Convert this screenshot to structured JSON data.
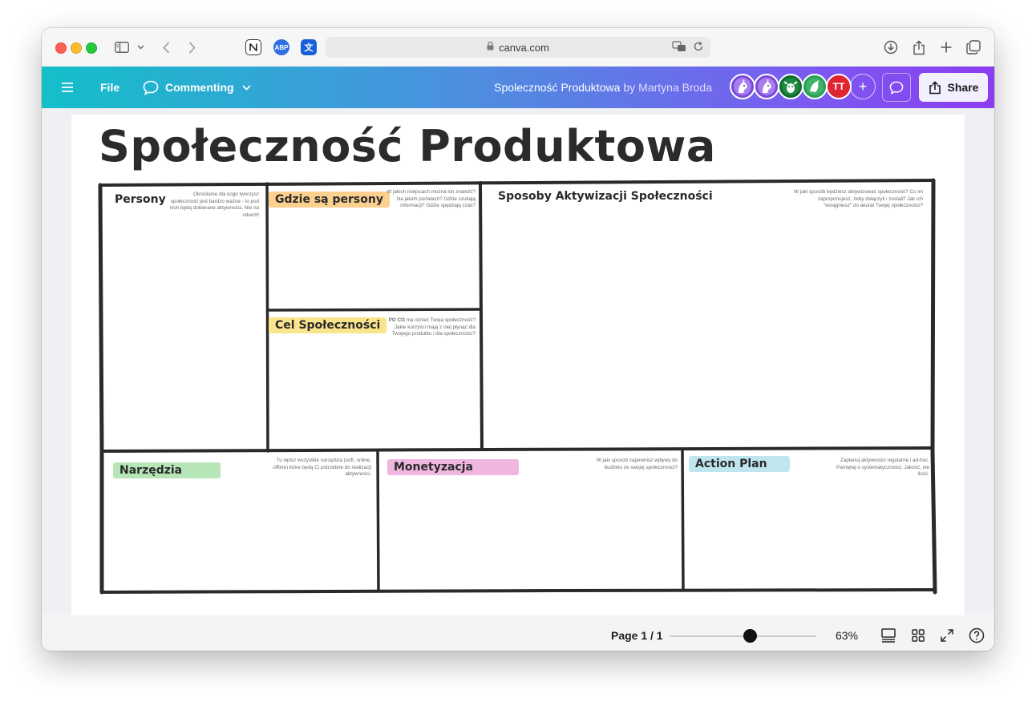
{
  "browser": {
    "url": "canva.com",
    "extensions": {
      "abp": "ABP",
      "translate": "文"
    }
  },
  "header": {
    "menu_icon": "hamburger-icon",
    "file_label": "File",
    "mode_label": "Commenting",
    "doc_title": "Spoleczność Produktowa",
    "by_label": "by",
    "author": "Martyna Broda",
    "avatar_initials": "TT",
    "add_label": "+",
    "share_label": "Share"
  },
  "canvas": {
    "title": "Społeczność Produktowa",
    "cells": {
      "persony": {
        "label": "Persony",
        "color": "#d7ecb4",
        "hint": "Określanie dla kogo tworzysz społeczność jest bardzo ważne - to pod nich będą dobierane aktywności. Nie na odwrót!"
      },
      "gdzie": {
        "label": "Gdzie są persony",
        "color": "#fbd08e",
        "hint": "W jakich miejscach można ich znaleźć? Na jakich portalach? Gdzie szukają informacji? Gdzie spędzają czas?"
      },
      "sposoby": {
        "label": "Sposoby Aktywizacji Społeczności",
        "color": "#fcae8a",
        "hint": "W jaki sposób będziesz aktywizować społeczność? Co im zaproponujesz, żeby dołączyli i zostali? Jak ich \"wciągniesz\" do akurat Twojej społeczności?"
      },
      "cel": {
        "label": "Cel Społeczności",
        "color": "#fbe58c",
        "hint_bold": "PO CO",
        "hint": "ma istnieć Twoja społeczność? Jakie korzyści mają z niej płynąć dla Twojego produktu i dla społeczności?"
      },
      "narzedzia": {
        "label": "Narzędzia",
        "color": "#b6e6b8",
        "hint": "Tu wpisz wszystkie narzędzia (soft, online, offline) które będą Ci potrzebne do realizacji aktywności."
      },
      "monetyzacja": {
        "label": "Monetyzacja",
        "color": "#efb6e0",
        "hint": "W jaki sposób zapewnisz wpływy do budżetu ze swojej społeczności?"
      },
      "action": {
        "label": "Action Plan",
        "color": "#bfe6ee",
        "hint": "Zaplanuj aktywności regularne i ad-hoc. Pamiętaj o systematyczności. Jakość, nie ilość."
      }
    }
  },
  "footer": {
    "page_label": "Page 1 / 1",
    "zoom_label": "63%",
    "zoom_value": 0.63
  }
}
